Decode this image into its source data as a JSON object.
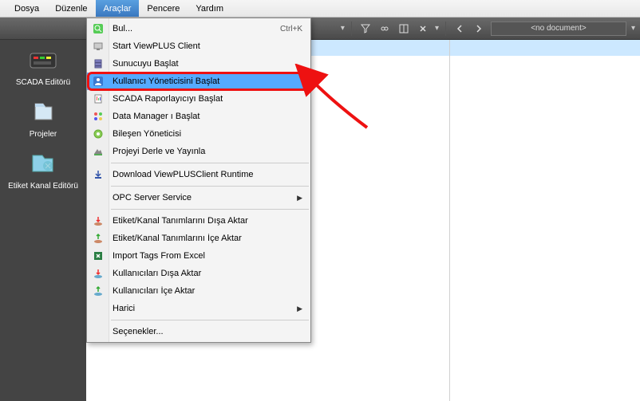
{
  "menubar": {
    "items": [
      "Dosya",
      "Düzenle",
      "Araçlar",
      "Pencere",
      "Yardım"
    ],
    "active_index": 2
  },
  "toolbar": {
    "doc_combo": "<no document>"
  },
  "sidebar": {
    "items": [
      {
        "label": "SCADA Editörü",
        "icon": "scada-editor-icon"
      },
      {
        "label": "Projeler",
        "icon": "projects-icon"
      },
      {
        "label": "Etiket Kanal Editörü",
        "icon": "tag-channel-editor-icon"
      }
    ]
  },
  "dropdown": {
    "items": [
      {
        "label": "Bul...",
        "shortcut": "Ctrl+K",
        "icon": "find-icon"
      },
      {
        "label": "Start ViewPLUS Client",
        "icon": "client-icon"
      },
      {
        "label": "Sunucuyu Başlat",
        "icon": "server-icon"
      },
      {
        "label": "Kullanıcı Yöneticisini Başlat",
        "icon": "user-manager-icon",
        "highlighted": true
      },
      {
        "label": "SCADA Raporlayıcıyı Başlat",
        "icon": "reporter-icon"
      },
      {
        "label": "Data Manager ı Başlat",
        "icon": "data-manager-icon"
      },
      {
        "label": "Bileşen Yöneticisi",
        "icon": "component-icon"
      },
      {
        "label": "Projeyi Derle ve Yayınla",
        "icon": "build-publish-icon"
      },
      {
        "sep": true
      },
      {
        "label": "Download ViewPLUSClient Runtime",
        "icon": "download-icon"
      },
      {
        "sep": true
      },
      {
        "label": "OPC Server Service",
        "icon": "opc-icon",
        "submenu": true
      },
      {
        "sep": true
      },
      {
        "label": "Etiket/Kanal Tanımlarını Dışa Aktar",
        "icon": "export-icon"
      },
      {
        "label": "Etiket/Kanal Tanımlarını İçe Aktar",
        "icon": "import-icon"
      },
      {
        "label": "Import Tags From Excel",
        "icon": "excel-icon"
      },
      {
        "label": "Kullanıcıları Dışa Aktar",
        "icon": "export-users-icon"
      },
      {
        "label": "Kullanıcıları İçe Aktar",
        "icon": "import-users-icon"
      },
      {
        "label": "Harici",
        "icon": "external-icon",
        "submenu": true
      },
      {
        "sep": true
      },
      {
        "label": "Seçenekler...",
        "icon": ""
      }
    ]
  }
}
